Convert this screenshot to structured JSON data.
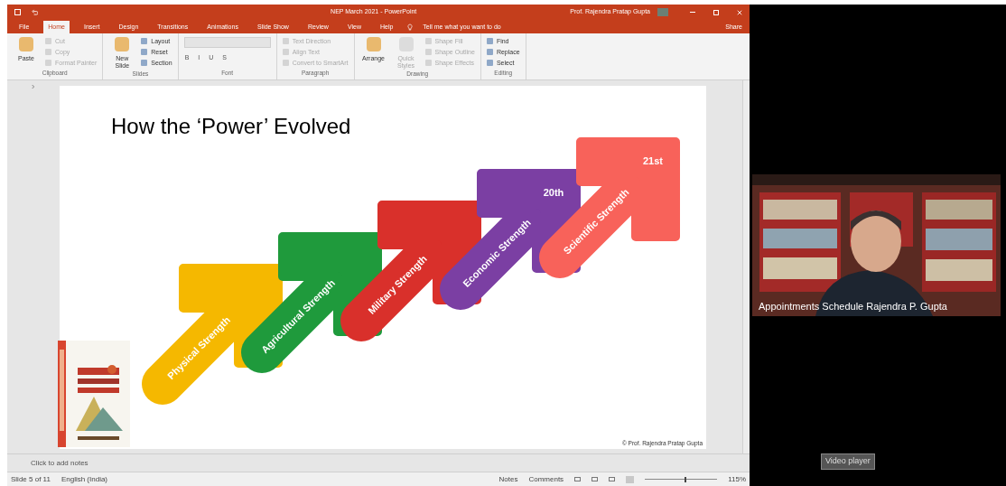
{
  "window": {
    "title": "NEP March 2021 - PowerPoint",
    "user": "Prof. Rajendra Pratap Gupta"
  },
  "tabs": [
    {
      "label": "File",
      "selected": false
    },
    {
      "label": "Home",
      "selected": true
    },
    {
      "label": "Insert",
      "selected": false
    },
    {
      "label": "Design",
      "selected": false
    },
    {
      "label": "Transitions",
      "selected": false
    },
    {
      "label": "Animations",
      "selected": false
    },
    {
      "label": "Slide Show",
      "selected": false
    },
    {
      "label": "Review",
      "selected": false
    },
    {
      "label": "View",
      "selected": false
    },
    {
      "label": "Help",
      "selected": false
    }
  ],
  "tell_me": "Tell me what you want to do",
  "share": "Share",
  "ribbon": [
    {
      "name": "Clipboard",
      "large": [
        {
          "label": "Paste",
          "disabled": false
        }
      ],
      "small": [
        {
          "label": "Cut",
          "disabled": true
        },
        {
          "label": "Copy",
          "disabled": true
        },
        {
          "label": "Format Painter",
          "disabled": true
        }
      ]
    },
    {
      "name": "Slides",
      "large": [
        {
          "label": "New Slide",
          "disabled": false
        }
      ],
      "small": [
        {
          "label": "Layout",
          "disabled": false
        },
        {
          "label": "Reset",
          "disabled": false
        },
        {
          "label": "Section",
          "disabled": false
        }
      ]
    },
    {
      "name": "Font",
      "format_buttons": [
        "B",
        "I",
        "U",
        "S"
      ]
    },
    {
      "name": "Paragraph",
      "small": [
        {
          "label": "Text Direction",
          "disabled": true
        },
        {
          "label": "Align Text",
          "disabled": true
        },
        {
          "label": "Convert to SmartArt",
          "disabled": true
        }
      ]
    },
    {
      "name": "Drawing",
      "large": [
        {
          "label": "Arrange",
          "disabled": false
        },
        {
          "label": "Quick Styles",
          "disabled": true
        }
      ],
      "small": [
        {
          "label": "Shape Fill",
          "disabled": true
        },
        {
          "label": "Shape Outline",
          "disabled": true
        },
        {
          "label": "Shape Effects",
          "disabled": true
        }
      ]
    },
    {
      "name": "Editing",
      "small": [
        {
          "label": "Find",
          "disabled": false
        },
        {
          "label": "Replace",
          "disabled": false
        },
        {
          "label": "Select",
          "disabled": false
        }
      ]
    }
  ],
  "slide": {
    "title": "How the ‘Power’ Evolved",
    "copyright": "© Prof. Rajendra Pratap Gupta",
    "arrows": [
      {
        "label": "Physical Strength",
        "color": "#f5b800"
      },
      {
        "label": "Agricultural Strength",
        "color": "#1f9a3c"
      },
      {
        "label": "Military Strength",
        "color": "#d9302b"
      },
      {
        "label": "Economic Strength",
        "color": "#7b3fa3",
        "era": "20th"
      },
      {
        "label": "Scientific Strength",
        "color": "#f8625a",
        "era": "21st"
      }
    ]
  },
  "notes_placeholder": "Click to add notes",
  "status_bar": {
    "slide": "Slide 5 of 11",
    "language": "English (India)",
    "notes": "Notes",
    "comments": "Comments",
    "zoom": {
      "level": 0.55,
      "reading": "115%"
    }
  },
  "video": {
    "caption": "Appointments Schedule Rajendra P. Gupta",
    "tooltip": "Video player"
  }
}
